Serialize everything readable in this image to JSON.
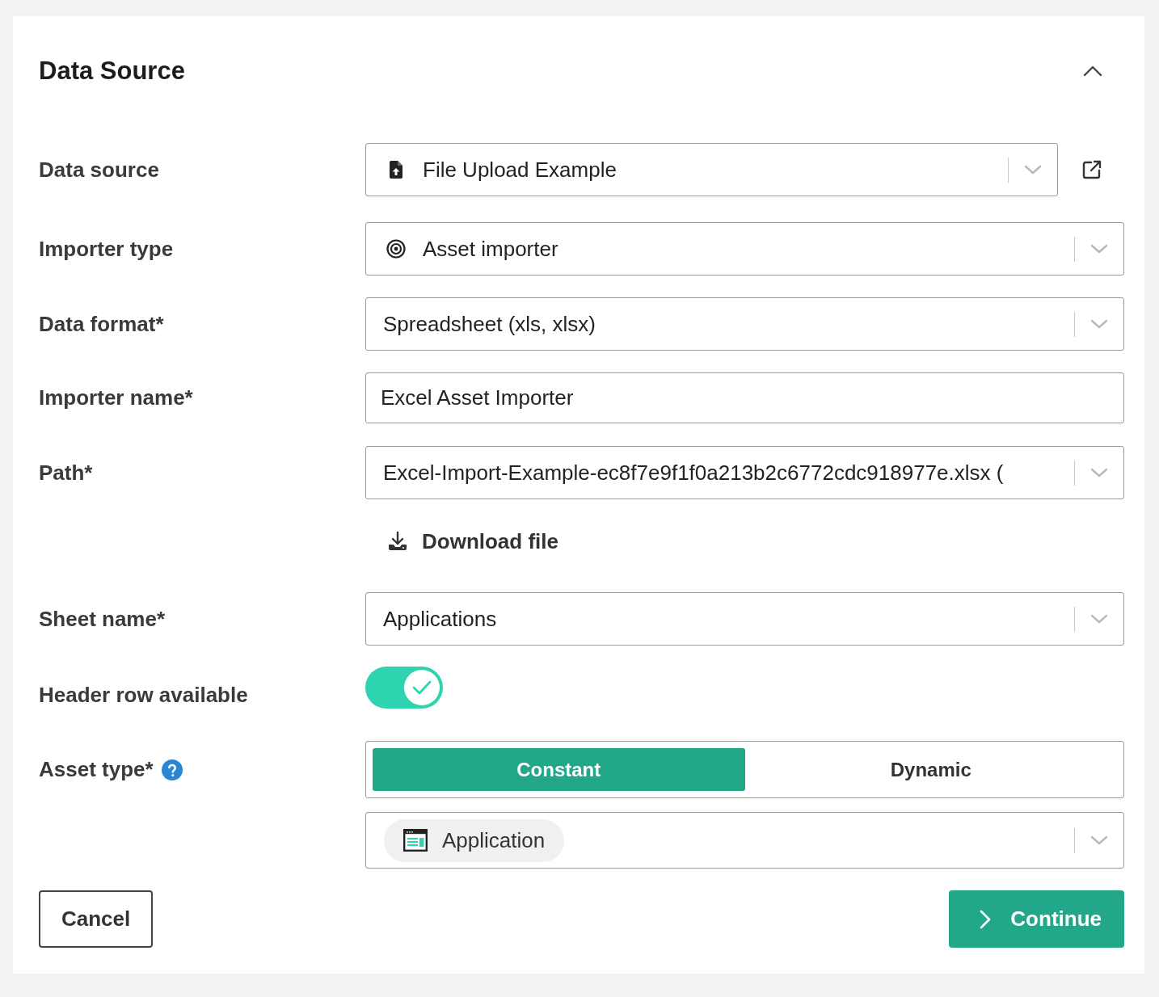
{
  "panel": {
    "title": "Data Source",
    "expanded": true
  },
  "data_source": {
    "label": "Data source",
    "value": "File Upload Example"
  },
  "importer_type": {
    "label": "Importer type",
    "value": "Asset importer"
  },
  "data_format": {
    "label": "Data format*",
    "value": "Spreadsheet (xls, xlsx)"
  },
  "importer_name": {
    "label": "Importer name*",
    "value": "Excel Asset Importer"
  },
  "path": {
    "label": "Path*",
    "value": "Excel-Import-Example-ec8f7e9f1f0a213b2c6772cdc918977e.xlsx (",
    "download_link": "Download file"
  },
  "sheet_name": {
    "label": "Sheet name*",
    "value": "Applications"
  },
  "header_row_available": {
    "label": "Header row available",
    "on": true
  },
  "asset_type": {
    "label": "Asset type*",
    "options": [
      {
        "label": "Constant",
        "selected": true
      },
      {
        "label": "Dynamic",
        "selected": false
      }
    ],
    "value": "Application"
  },
  "buttons": [
    {
      "label": "Cancel",
      "kind": "secondary"
    },
    {
      "label": "Continue",
      "kind": "primary"
    }
  ]
}
